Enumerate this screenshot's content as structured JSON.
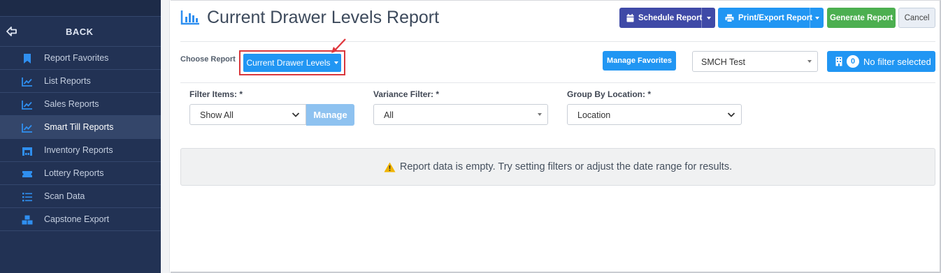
{
  "sidebar": {
    "back_label": "BACK",
    "items": [
      {
        "label": "Report Favorites",
        "icon": "bookmark-icon"
      },
      {
        "label": "List Reports",
        "icon": "line-chart-icon"
      },
      {
        "label": "Sales Reports",
        "icon": "line-chart-icon"
      },
      {
        "label": "Smart Till Reports",
        "icon": "line-chart-icon",
        "active": true
      },
      {
        "label": "Inventory Reports",
        "icon": "warehouse-icon"
      },
      {
        "label": "Lottery Reports",
        "icon": "ticket-icon"
      },
      {
        "label": "Scan Data",
        "icon": "list-icon"
      },
      {
        "label": "Capstone Export",
        "icon": "boxes-icon"
      }
    ]
  },
  "header": {
    "title": "Current Drawer Levels Report",
    "schedule_label": "Schedule Report",
    "print_label": "Print/Export Report",
    "generate_label": "Generate Report",
    "cancel_label": "Cancel"
  },
  "toolbar": {
    "choose_label": "Choose Report",
    "report_selected": "Current Drawer Levels",
    "manage_favorites_label": "Manage Favorites",
    "store_value": "SMCH Test",
    "filter_count": "0",
    "filter_label": "No filter selected"
  },
  "filters": {
    "items_label": "Filter Items: *",
    "items_value": "Show All",
    "manage_label": "Manage",
    "variance_label": "Variance Filter: *",
    "variance_value": "All",
    "group_label": "Group By Location: *",
    "group_value": "Location"
  },
  "empty_message": "Report data is empty. Try setting filters or adjust the date range for results.",
  "colors": {
    "sidebar_bg": "#223254",
    "primary": "#2196f3",
    "schedule": "#3f4aa7",
    "generate": "#4caf50",
    "highlight": "#d9373c"
  }
}
